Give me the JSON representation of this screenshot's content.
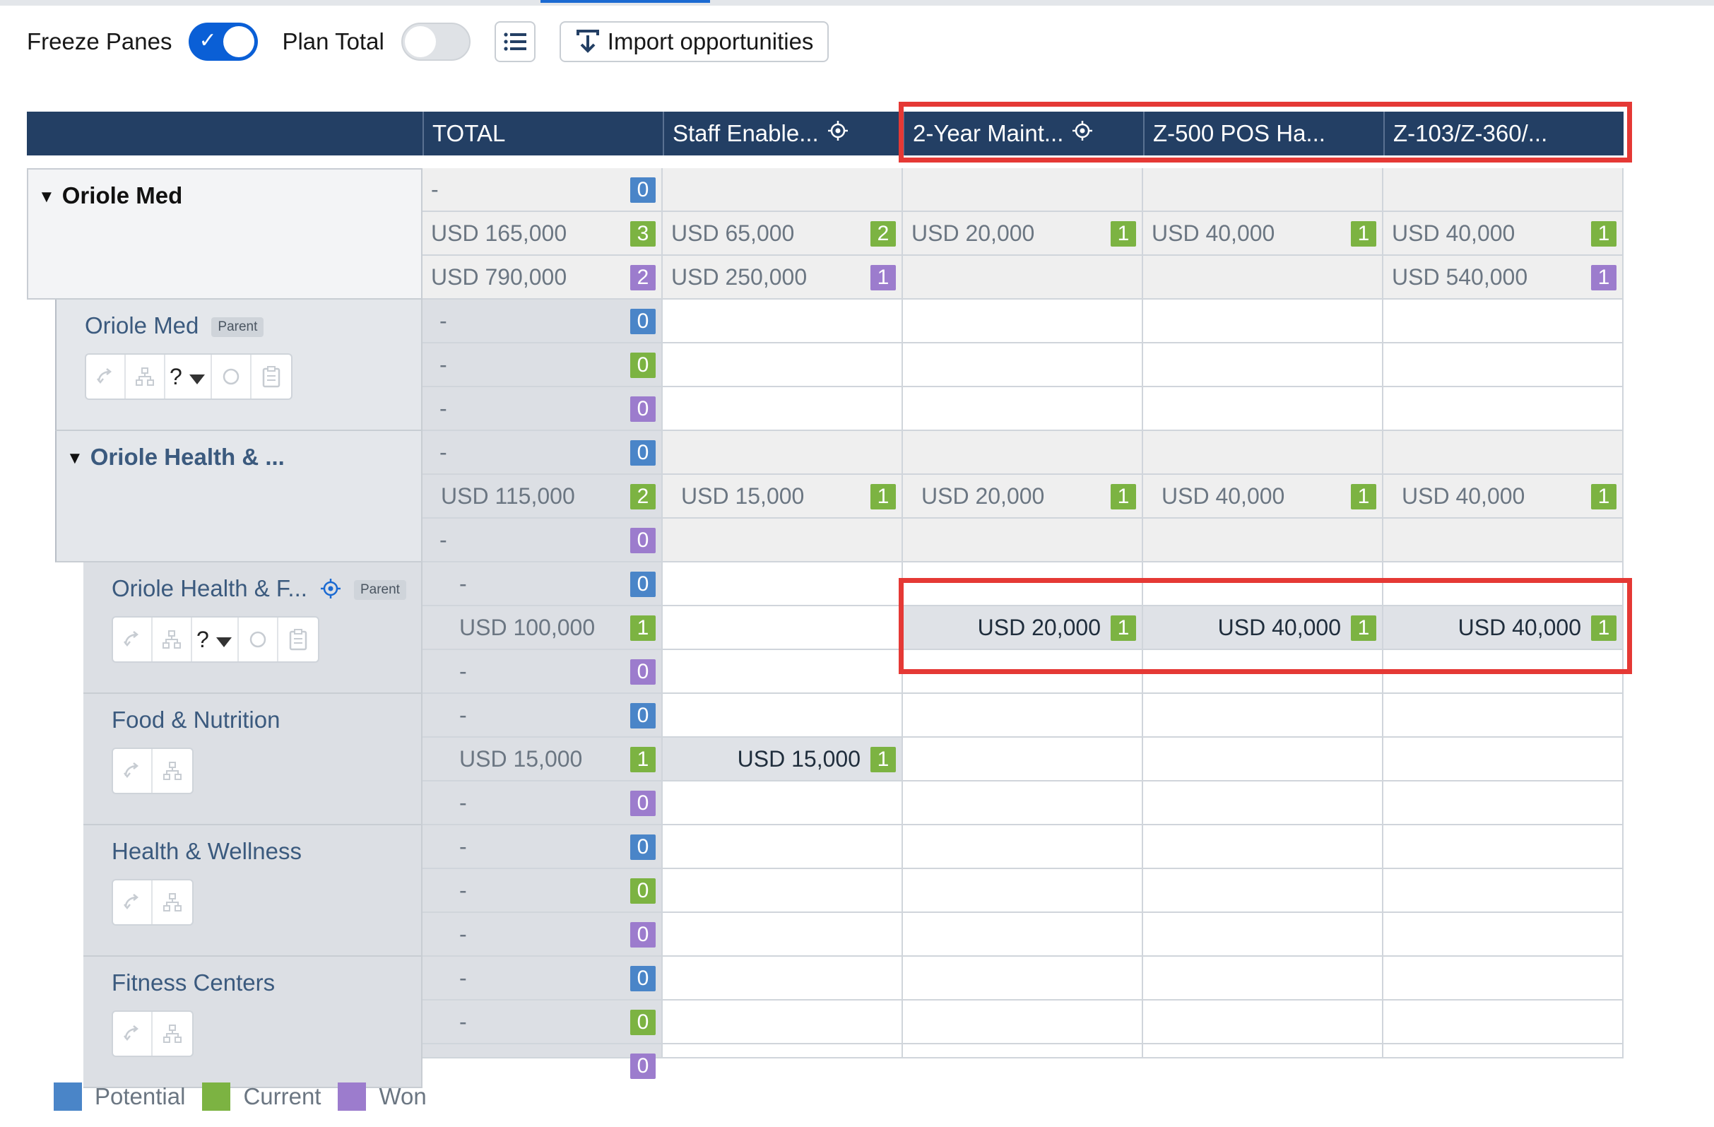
{
  "toolbar": {
    "freeze_panes_label": "Freeze Panes",
    "freeze_panes_on": true,
    "plan_total_label": "Plan Total",
    "plan_total_on": false,
    "import_label": "Import opportunities"
  },
  "columns": [
    {
      "label": ""
    },
    {
      "label": "TOTAL"
    },
    {
      "label": "Staff Enable..."
    },
    {
      "label": "2-Year Maint..."
    },
    {
      "label": "Z-500 POS Ha..."
    },
    {
      "label": "Z-103/Z-360/..."
    }
  ],
  "accounts": [
    {
      "name": "Oriole Med"
    },
    {
      "name": "Oriole Med",
      "tag": "Parent",
      "question": "?"
    },
    {
      "name": "Oriole Health & ..."
    },
    {
      "name": "Oriole Health & F...",
      "tag": "Parent",
      "question": "?"
    },
    {
      "name": "Food & Nutrition"
    },
    {
      "name": "Health & Wellness"
    },
    {
      "name": "Fitness Centers"
    }
  ],
  "rows": [
    [
      [
        "-",
        "0"
      ],
      null,
      null,
      null,
      null
    ],
    [
      [
        "USD 165,000",
        "3"
      ],
      [
        "USD 65,000",
        "2"
      ],
      [
        "USD 20,000",
        "1"
      ],
      [
        "USD 40,000",
        "1"
      ],
      [
        "USD 40,000",
        "1"
      ]
    ],
    [
      [
        "USD 790,000",
        "2"
      ],
      [
        "USD 250,000",
        "1"
      ],
      null,
      null,
      [
        "USD 540,000",
        "1"
      ]
    ],
    [
      [
        "-",
        "0"
      ],
      null,
      null,
      null,
      null
    ],
    [
      [
        "-",
        "0"
      ],
      null,
      null,
      null,
      null
    ],
    [
      [
        "-",
        "0"
      ],
      null,
      null,
      null,
      null
    ],
    [
      [
        "-",
        "0"
      ],
      null,
      null,
      null,
      null
    ],
    [
      [
        "USD 115,000",
        "2"
      ],
      [
        "USD 15,000",
        "1"
      ],
      [
        "USD 20,000",
        "1"
      ],
      [
        "USD 40,000",
        "1"
      ],
      [
        "USD 40,000",
        "1"
      ]
    ],
    [
      [
        "-",
        "0"
      ],
      null,
      null,
      null,
      null
    ],
    [
      [
        "-",
        "0"
      ],
      null,
      null,
      null,
      null
    ],
    [
      [
        "USD 100,000",
        "1"
      ],
      null,
      [
        "USD 20,000",
        "1"
      ],
      [
        "USD 40,000",
        "1"
      ],
      [
        "USD 40,000",
        "1"
      ]
    ],
    [
      [
        "-",
        "0"
      ],
      null,
      null,
      null,
      null
    ],
    [
      [
        "-",
        "0"
      ],
      null,
      null,
      null,
      null
    ],
    [
      [
        "USD 15,000",
        "1"
      ],
      [
        "USD 15,000",
        "1"
      ],
      null,
      null,
      null
    ],
    [
      [
        "-",
        "0"
      ],
      null,
      null,
      null,
      null
    ],
    [
      [
        "-",
        "0"
      ],
      null,
      null,
      null,
      null
    ],
    [
      [
        "-",
        "0"
      ],
      null,
      null,
      null,
      null
    ],
    [
      [
        "-",
        "0"
      ],
      null,
      null,
      null,
      null
    ],
    [
      [
        "-",
        "0"
      ],
      null,
      null,
      null,
      null
    ],
    [
      [
        "-",
        "0"
      ],
      null,
      null,
      null,
      null
    ],
    [
      [
        "",
        "0"
      ],
      null,
      null,
      null,
      null
    ]
  ],
  "legend": [
    {
      "label": "Potential",
      "color": "#4a85c8"
    },
    {
      "label": "Current",
      "color": "#7cb342"
    },
    {
      "label": "Won",
      "color": "#9c7ccd"
    }
  ],
  "colors": {
    "header": "#233f64",
    "highlight": "#e53935",
    "toggle_on": "#0a5fd6"
  }
}
